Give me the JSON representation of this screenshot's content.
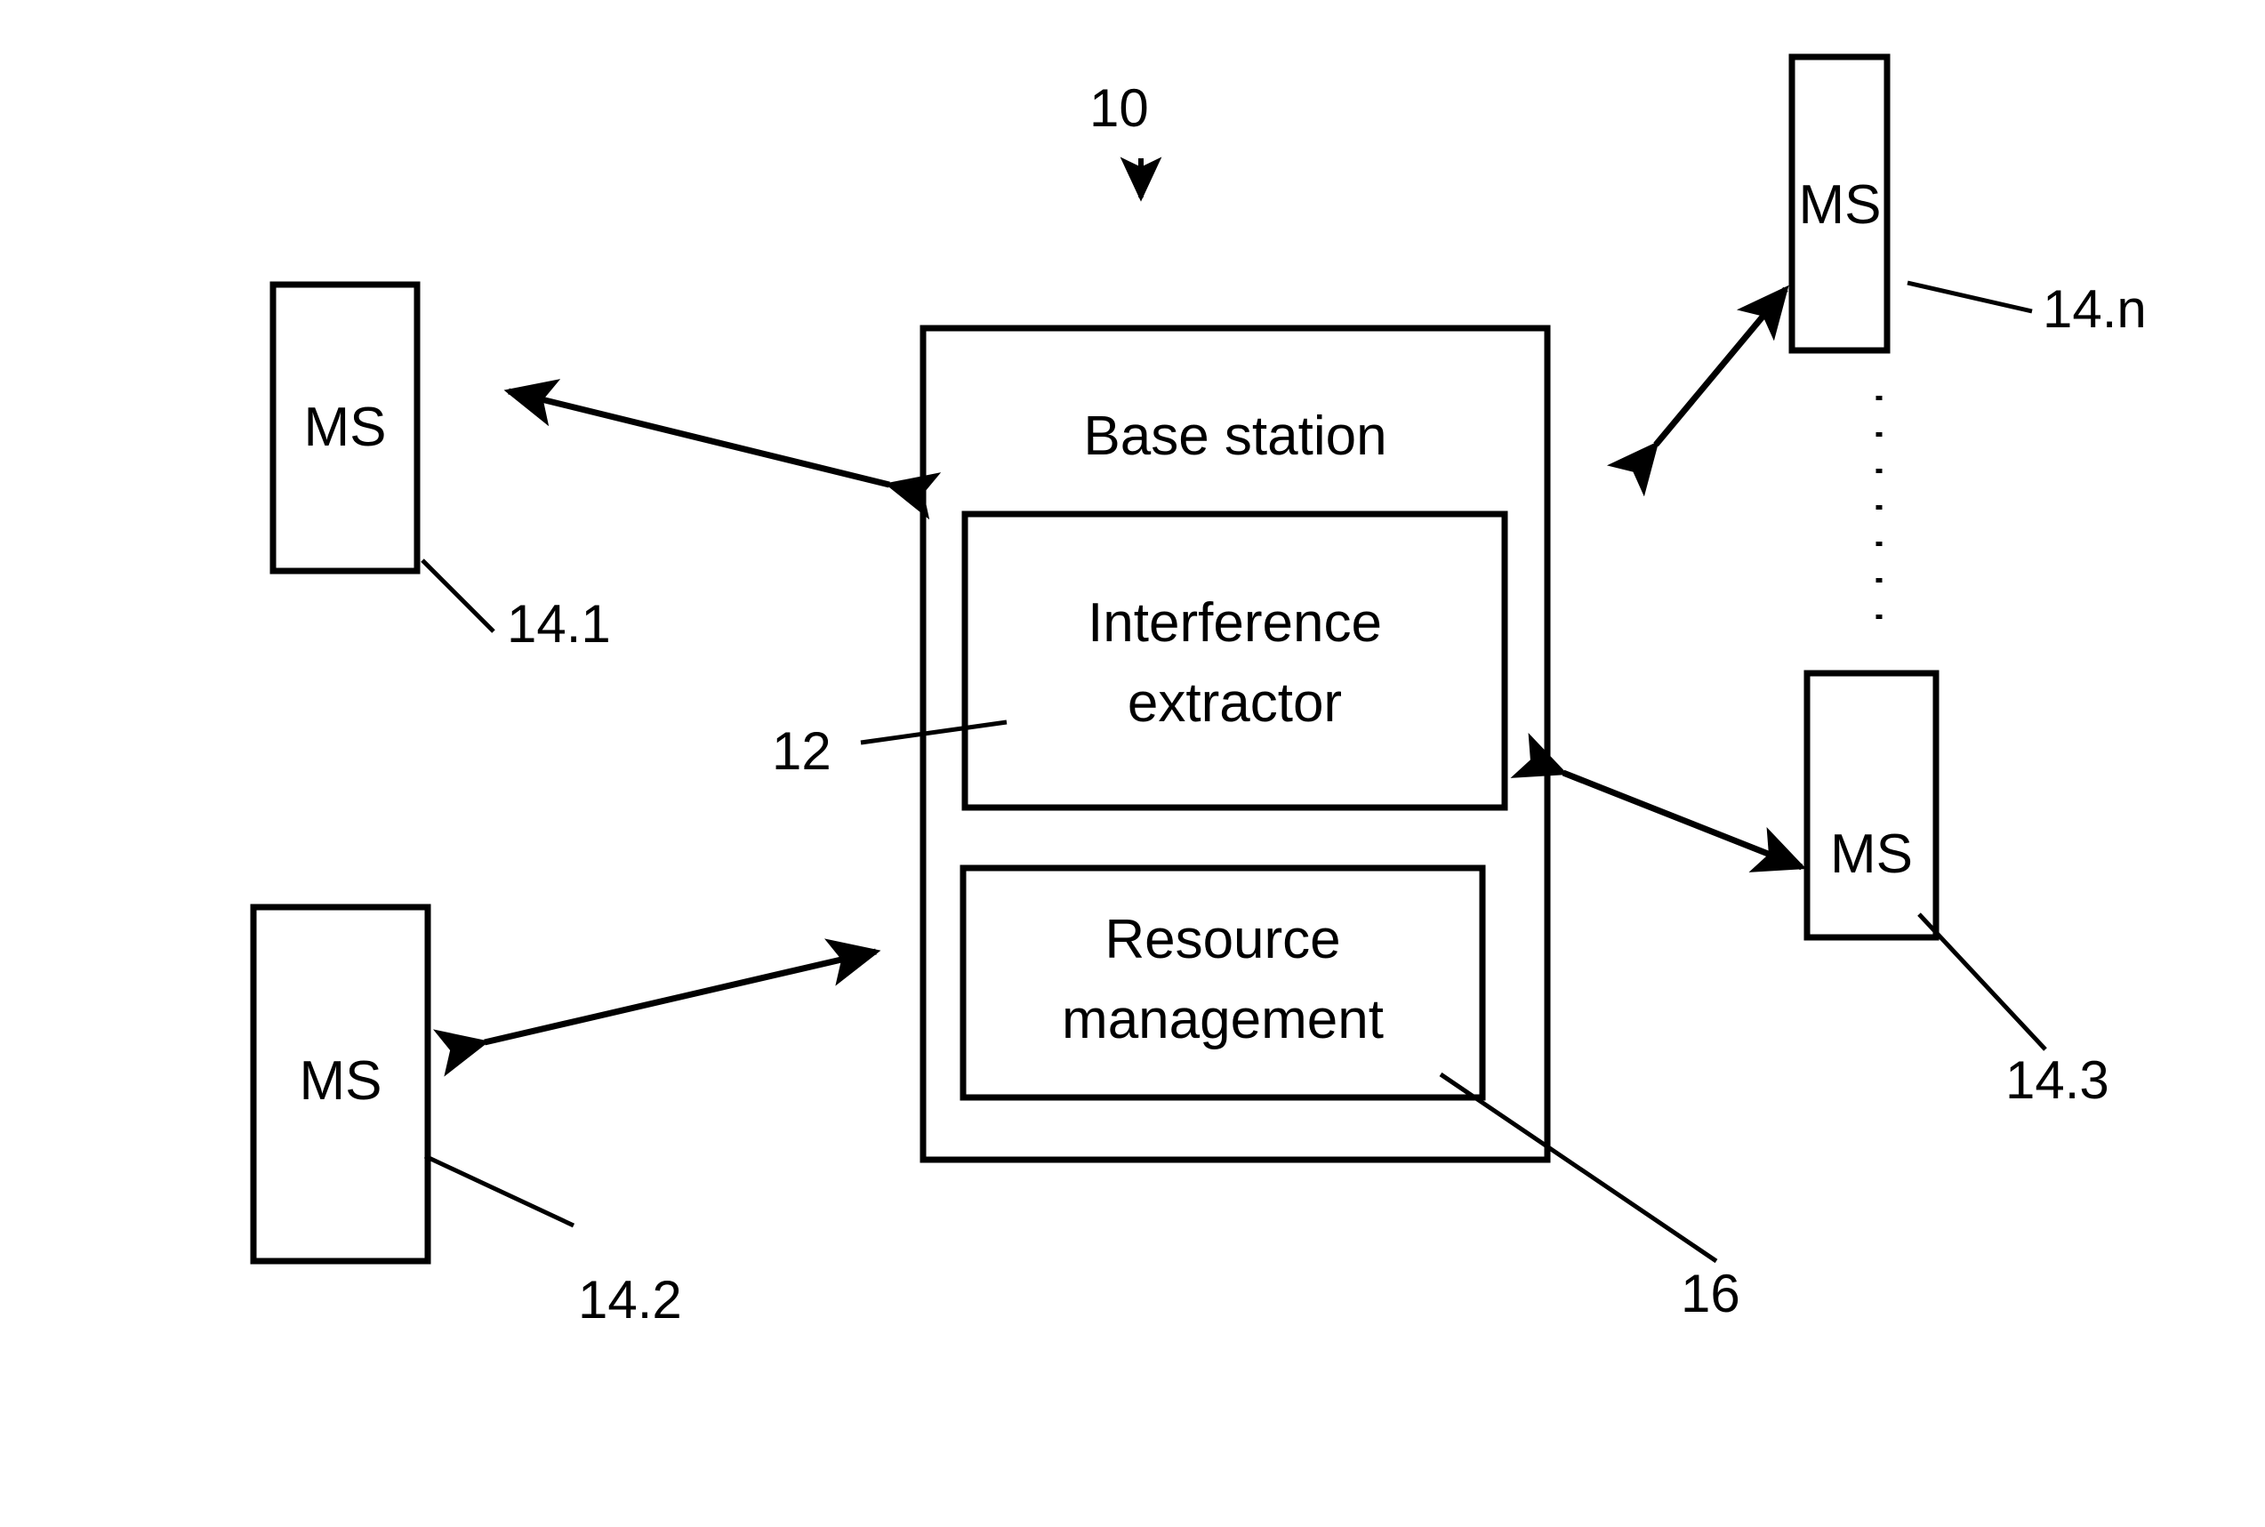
{
  "figure": {
    "type": "patent-block-diagram",
    "background_color": "#ffffff",
    "line_color": "#000000"
  },
  "base_station": {
    "title": "Base station",
    "ref": "10",
    "modules": [
      {
        "label": "Interference extractor",
        "label_line1": "Interference",
        "label_line2": "extractor",
        "ref": "12"
      },
      {
        "label": "Resource management",
        "label_line1": "Resource",
        "label_line2": "management",
        "ref": "16"
      }
    ]
  },
  "mobile_stations": [
    {
      "label": "MS",
      "ref": "14.1",
      "position": "top-left"
    },
    {
      "label": "MS",
      "ref": "14.2",
      "position": "bottom-left"
    },
    {
      "label": "MS",
      "ref": "14.n",
      "position": "top-right"
    },
    {
      "label": "MS",
      "ref": "14.3",
      "position": "bottom-right"
    }
  ],
  "connections": [
    {
      "from": "14.1",
      "to": "10",
      "style": "double-arrow"
    },
    {
      "from": "14.2",
      "to": "10",
      "style": "double-arrow"
    },
    {
      "from": "14.n",
      "to": "10",
      "style": "double-arrow"
    },
    {
      "from": "14.3",
      "to": "10",
      "style": "double-arrow"
    }
  ],
  "ellipsis": {
    "style": "vertical-dotted",
    "between": [
      "14.n",
      "14.3"
    ]
  }
}
